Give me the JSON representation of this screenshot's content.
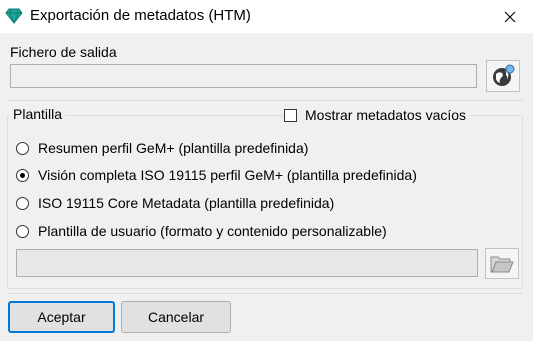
{
  "window": {
    "title": "Exportación de metadatos (HTM)",
    "icon": "gem-icon",
    "close_icon": "close-icon"
  },
  "output": {
    "label": "Fichero de salida",
    "value": "",
    "browse_icon": "globe-icon"
  },
  "template": {
    "group_label": "Plantilla",
    "show_empty": {
      "label": "Mostrar metadatos vacíos",
      "checked": false
    },
    "options": [
      {
        "label": "Resumen perfil GeM+ (plantilla predefinida)",
        "selected": false
      },
      {
        "label": "Visión completa ISO 19115 perfil GeM+ (plantilla predefinida)",
        "selected": true
      },
      {
        "label": "ISO 19115 Core Metadata (plantilla predefinida)",
        "selected": false
      },
      {
        "label": "Plantilla de usuario (formato y contenido personalizable)",
        "selected": false
      }
    ],
    "user_template_path": "",
    "folder_icon": "folder-open-icon"
  },
  "buttons": {
    "accept": "Aceptar",
    "cancel": "Cancelar"
  },
  "colors": {
    "accent": "#0078d7",
    "gem": "#1aa89a"
  }
}
